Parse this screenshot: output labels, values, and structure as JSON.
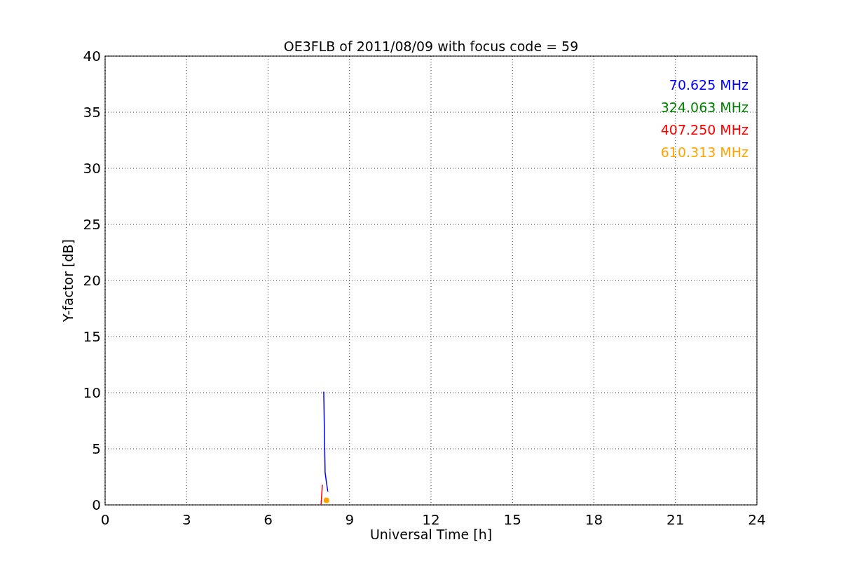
{
  "chart_data": {
    "type": "line",
    "title": "OE3FLB of 2011/08/09 with focus code = 59",
    "xlabel": "Universal Time [h]",
    "ylabel": "Y-factor [dB]",
    "x": [
      7.95,
      8.0,
      8.05,
      8.1,
      8.15,
      8.2
    ],
    "series": [
      {
        "name": "70.625 MHz",
        "color": "#0000ff",
        "values": [
          null,
          null,
          10.1,
          2.9,
          2.0,
          1.2
        ]
      },
      {
        "name": "324.063 MHz",
        "color": "#008000",
        "values": [
          null,
          null,
          null,
          null,
          null,
          null
        ]
      },
      {
        "name": "407.250 MHz",
        "color": "#ff0000",
        "values": [
          0,
          1.8,
          null,
          null,
          null,
          null
        ]
      },
      {
        "name": "610.313 MHz",
        "color": "#ffa500",
        "type": "scatter",
        "values": [
          null,
          null,
          null,
          null,
          0.4,
          null
        ]
      }
    ],
    "xlim": [
      0,
      24
    ],
    "ylim": [
      0,
      40
    ],
    "xticks": [
      0,
      3,
      6,
      9,
      12,
      15,
      18,
      21,
      24
    ],
    "yticks": [
      0,
      5,
      10,
      15,
      20,
      25,
      30,
      35,
      40
    ],
    "grid": true
  }
}
